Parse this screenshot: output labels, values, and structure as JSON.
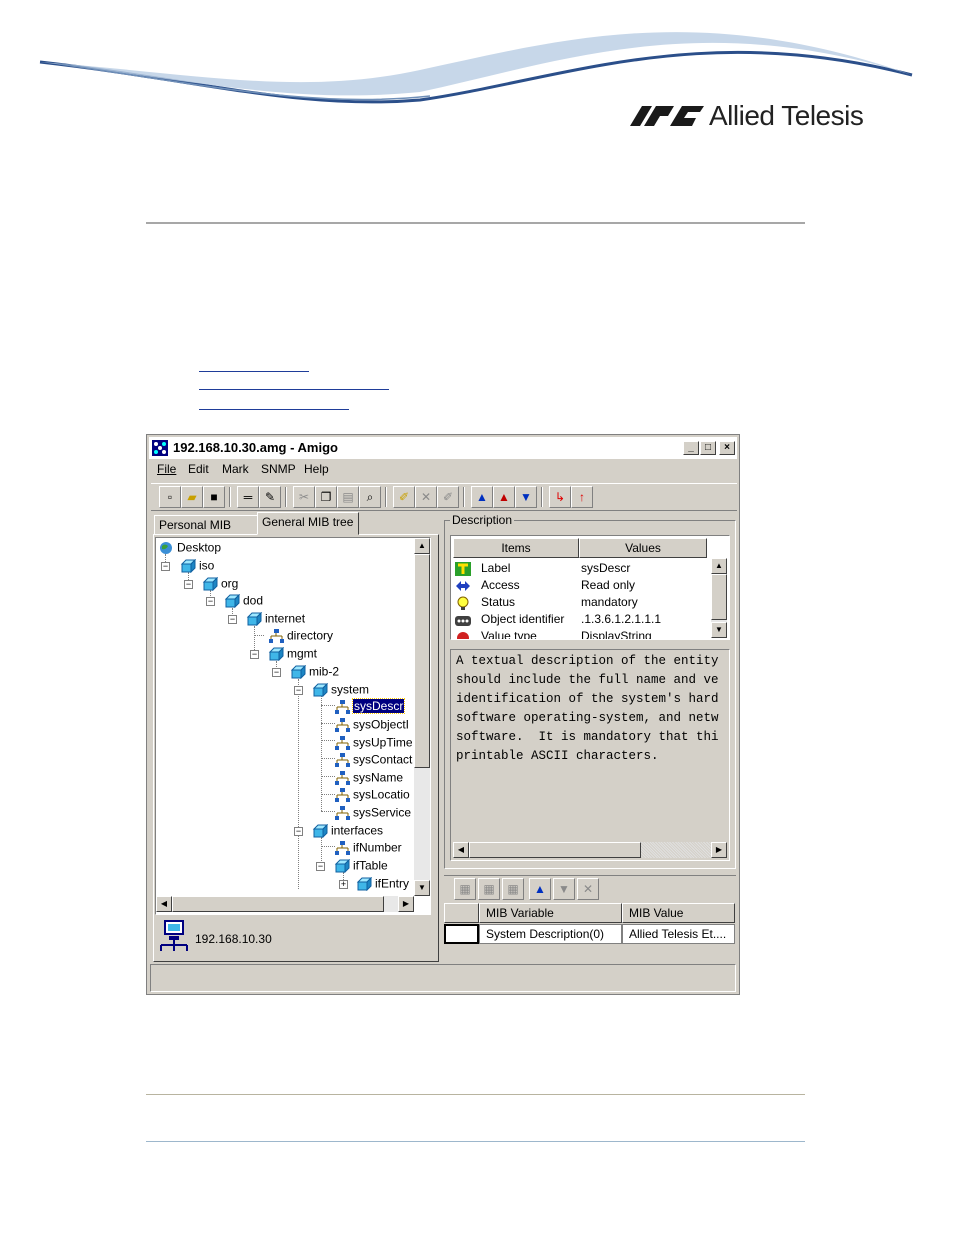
{
  "header": {
    "logo_text": "Allied Telesis"
  },
  "window": {
    "title": "192.168.10.30.amg - Amigo",
    "menu": [
      "File",
      "Edit",
      "Mark",
      "SNMP",
      "Help"
    ],
    "toolbar_icons": [
      "new-icon",
      "open-icon",
      "save-icon",
      "connect-icon",
      "tools-icon",
      "cut-icon",
      "copy-icon",
      "paste-icon",
      "find-icon",
      "mark-icon",
      "unmark-icon",
      "clear-mark-icon",
      "get-icon",
      "get-next-icon",
      "get-bulk-icon",
      "set-icon",
      "trap-icon"
    ],
    "tabs": [
      "Personal MIB tree",
      "General MIB tree"
    ],
    "active_tab": "General MIB tree",
    "tree": [
      {
        "label": "Desktop",
        "icon": "globe-icon"
      },
      {
        "label": "iso",
        "icon": "folder-icon"
      },
      {
        "label": "org",
        "icon": "folder-icon"
      },
      {
        "label": "dod",
        "icon": "folder-icon"
      },
      {
        "label": "internet",
        "icon": "folder-icon"
      },
      {
        "label": "directory",
        "icon": "leaf-icon"
      },
      {
        "label": "mgmt",
        "icon": "folder-icon"
      },
      {
        "label": "mib-2",
        "icon": "folder-icon"
      },
      {
        "label": "system",
        "icon": "folder-icon"
      },
      {
        "label": "sysDescr",
        "icon": "leaf-icon"
      },
      {
        "label": "sysObjectI",
        "icon": "leaf-icon"
      },
      {
        "label": "sysUpTime",
        "icon": "leaf-icon"
      },
      {
        "label": "sysContact",
        "icon": "leaf-icon"
      },
      {
        "label": "sysName",
        "icon": "leaf-icon"
      },
      {
        "label": "sysLocatio",
        "icon": "leaf-icon"
      },
      {
        "label": "sysService",
        "icon": "leaf-icon"
      },
      {
        "label": "interfaces",
        "icon": "folder-icon"
      },
      {
        "label": "ifNumber",
        "icon": "leaf-icon"
      },
      {
        "label": "ifTable",
        "icon": "folder-icon"
      },
      {
        "label": "ifEntry",
        "icon": "folder-icon"
      }
    ],
    "selected_node": "sysDescr",
    "host": "192.168.10.30",
    "description": {
      "legend": "Description",
      "col_items": "Items",
      "col_values": "Values",
      "rows": [
        {
          "item": "Label",
          "value": "sysDescr",
          "icon": "label-icon"
        },
        {
          "item": "Access",
          "value": "Read only",
          "icon": "access-icon"
        },
        {
          "item": "Status",
          "value": "mandatory",
          "icon": "status-icon"
        },
        {
          "item": "Object identifier",
          "value": ".1.3.6.1.2.1.1.1",
          "icon": "oid-icon"
        },
        {
          "item": "Value type",
          "value": "DisplayString",
          "icon": "value-type-icon"
        }
      ],
      "text_lines": [
        "A textual description of the entity",
        "should include the full name and ve",
        "identification of the system's hard",
        "software operating-system, and netw",
        "software.  It is mandatory that thi",
        "printable ASCII characters."
      ]
    },
    "mib_table": {
      "col_variable": "MIB Variable",
      "col_value": "MIB Value",
      "rows": [
        {
          "variable": "System Description(0)",
          "value": "Allied Telesis Et...."
        }
      ]
    }
  }
}
